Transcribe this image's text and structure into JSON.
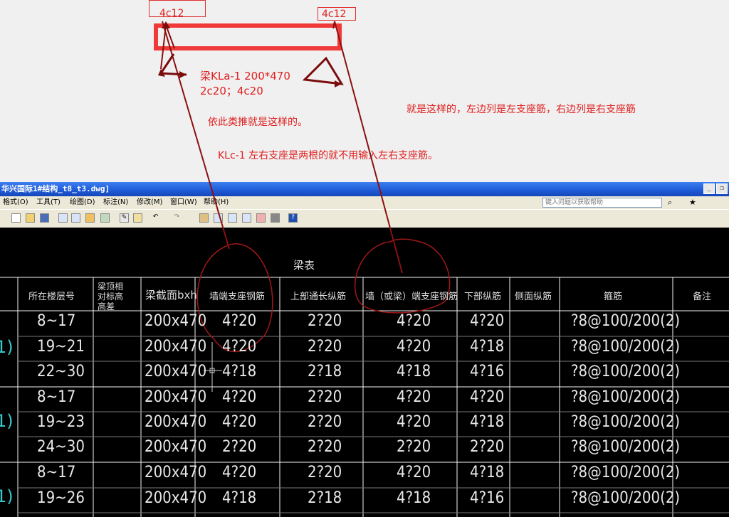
{
  "annotations": {
    "tag_left": "4c12",
    "tag_right": "4c12",
    "beam_label_line1": "梁KLa-1 200*470",
    "beam_label_line2": "2c20；4c20",
    "note_infer": "依此类推就是这样的。",
    "note_klc": "KLc-1 左右支座是两根的就不用输入左右支座筋。",
    "note_right": "就是这样的，左边列是左支座筋，右边列是右支座筋",
    "color": "#e02020"
  },
  "window": {
    "title": "华兴国际1#结构_t8_t3.dwg]",
    "minimize_label": "_",
    "restore_label": "❐"
  },
  "menu": {
    "items": [
      "格式(O)",
      "工具(T)",
      "绘图(D)",
      "标注(N)",
      "修改(M)",
      "窗口(W)",
      "帮助(H)"
    ],
    "help_placeholder": "键入问题以获取帮助"
  },
  "table": {
    "title": "梁表",
    "headers": [
      "所在楼层号",
      "梁顶相对标高高差",
      "梁截面bxh",
      "墙端支座钢筋",
      "上部通长纵筋",
      "墙（或梁）端支座钢筋",
      "下部纵筋",
      "侧面纵筋",
      "箍筋",
      "备注"
    ],
    "rows": [
      [
        "8~17",
        "",
        "200x470",
        "4?20",
        "2?20",
        "4?20",
        "4?20",
        "",
        "?8@100/200(2)",
        ""
      ],
      [
        "19~21",
        "",
        "200x470",
        "4?20",
        "2?20",
        "4?20",
        "4?18",
        "",
        "?8@100/200(2)",
        ""
      ],
      [
        "22~30",
        "",
        "200x470",
        "4?18",
        "2?18",
        "4?18",
        "4?16",
        "",
        "?8@100/200(2)",
        ""
      ],
      [
        "8~17",
        "",
        "200x470",
        "4?20",
        "2?20",
        "4?20",
        "4?20",
        "",
        "?8@100/200(2)",
        ""
      ],
      [
        "19~23",
        "",
        "200x470",
        "4?20",
        "2?20",
        "4?20",
        "4?18",
        "",
        "?8@100/200(2)",
        ""
      ],
      [
        "24~30",
        "",
        "200x470",
        "2?20",
        "2?20",
        "2?20",
        "2?20",
        "",
        "?8@100/200(2)",
        ""
      ],
      [
        "8~17",
        "",
        "200x470",
        "4?20",
        "2?20",
        "4?20",
        "4?18",
        "",
        "?8@100/200(2)",
        ""
      ],
      [
        "19~26",
        "",
        "200x470",
        "4?18",
        "2?18",
        "4?18",
        "4?16",
        "",
        "?8@100/200(2)",
        ""
      ]
    ],
    "group_marks": [
      "1)",
      "1)",
      "1)"
    ]
  }
}
